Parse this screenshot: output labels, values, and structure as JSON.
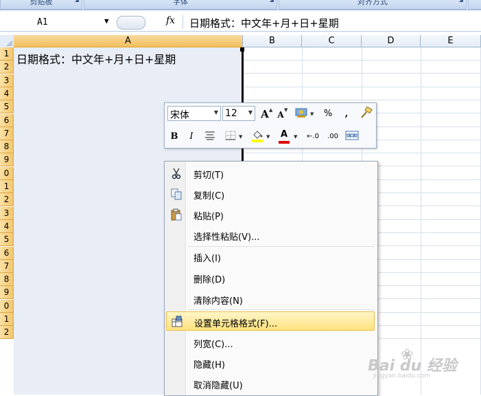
{
  "ribbon": {
    "groups": [
      "剪贴板",
      "字体",
      "对齐方式"
    ]
  },
  "formula_bar": {
    "name_box": "A1",
    "fx_label": "fx",
    "formula": "日期格式：中文年+月+日+星期"
  },
  "grid": {
    "columns": [
      "A",
      "B",
      "C",
      "D",
      "E"
    ],
    "rows": [
      "1",
      "2",
      "3",
      "4",
      "5",
      "6",
      "7",
      "8",
      "9",
      "0",
      "1",
      "2",
      "3",
      "4",
      "5",
      "6",
      "7",
      "8",
      "9",
      "0",
      "1",
      "2"
    ],
    "cell_a1": "日期格式：中文年+月+日+星期"
  },
  "mini_toolbar": {
    "font": "宋体",
    "size": "12",
    "grow_font": "A",
    "shrink_font": "A",
    "percent": "%",
    "comma": ",",
    "bold": "B",
    "italic": "I",
    "font_color_letter": "A",
    "increase_decimal": "←.0",
    "decrease_decimal": ".00"
  },
  "context_menu": {
    "items": [
      {
        "label": "剪切(T)",
        "icon": "scissors-icon"
      },
      {
        "label": "复制(C)",
        "icon": "copy-icon"
      },
      {
        "label": "粘贴(P)",
        "icon": "paste-icon"
      },
      {
        "label": "选择性粘贴(V)..."
      },
      {
        "label": "插入(I)"
      },
      {
        "label": "删除(D)"
      },
      {
        "label": "清除内容(N)"
      },
      {
        "label": "设置单元格格式(F)...",
        "icon": "format-cells-icon",
        "highlighted": true
      },
      {
        "label": "列宽(C)..."
      },
      {
        "label": "隐藏(H)"
      },
      {
        "label": "取消隐藏(U)"
      }
    ]
  },
  "watermark": {
    "main": "Bai du 经验",
    "sub": "jingyan.baidu.com"
  },
  "colors": {
    "selection": "#e9edf6",
    "header_selected": "#f3c66c",
    "menu_highlight": "#ffe27e",
    "font_color_bar": "#e00000",
    "highlight_color_bar": "#ffff00"
  }
}
